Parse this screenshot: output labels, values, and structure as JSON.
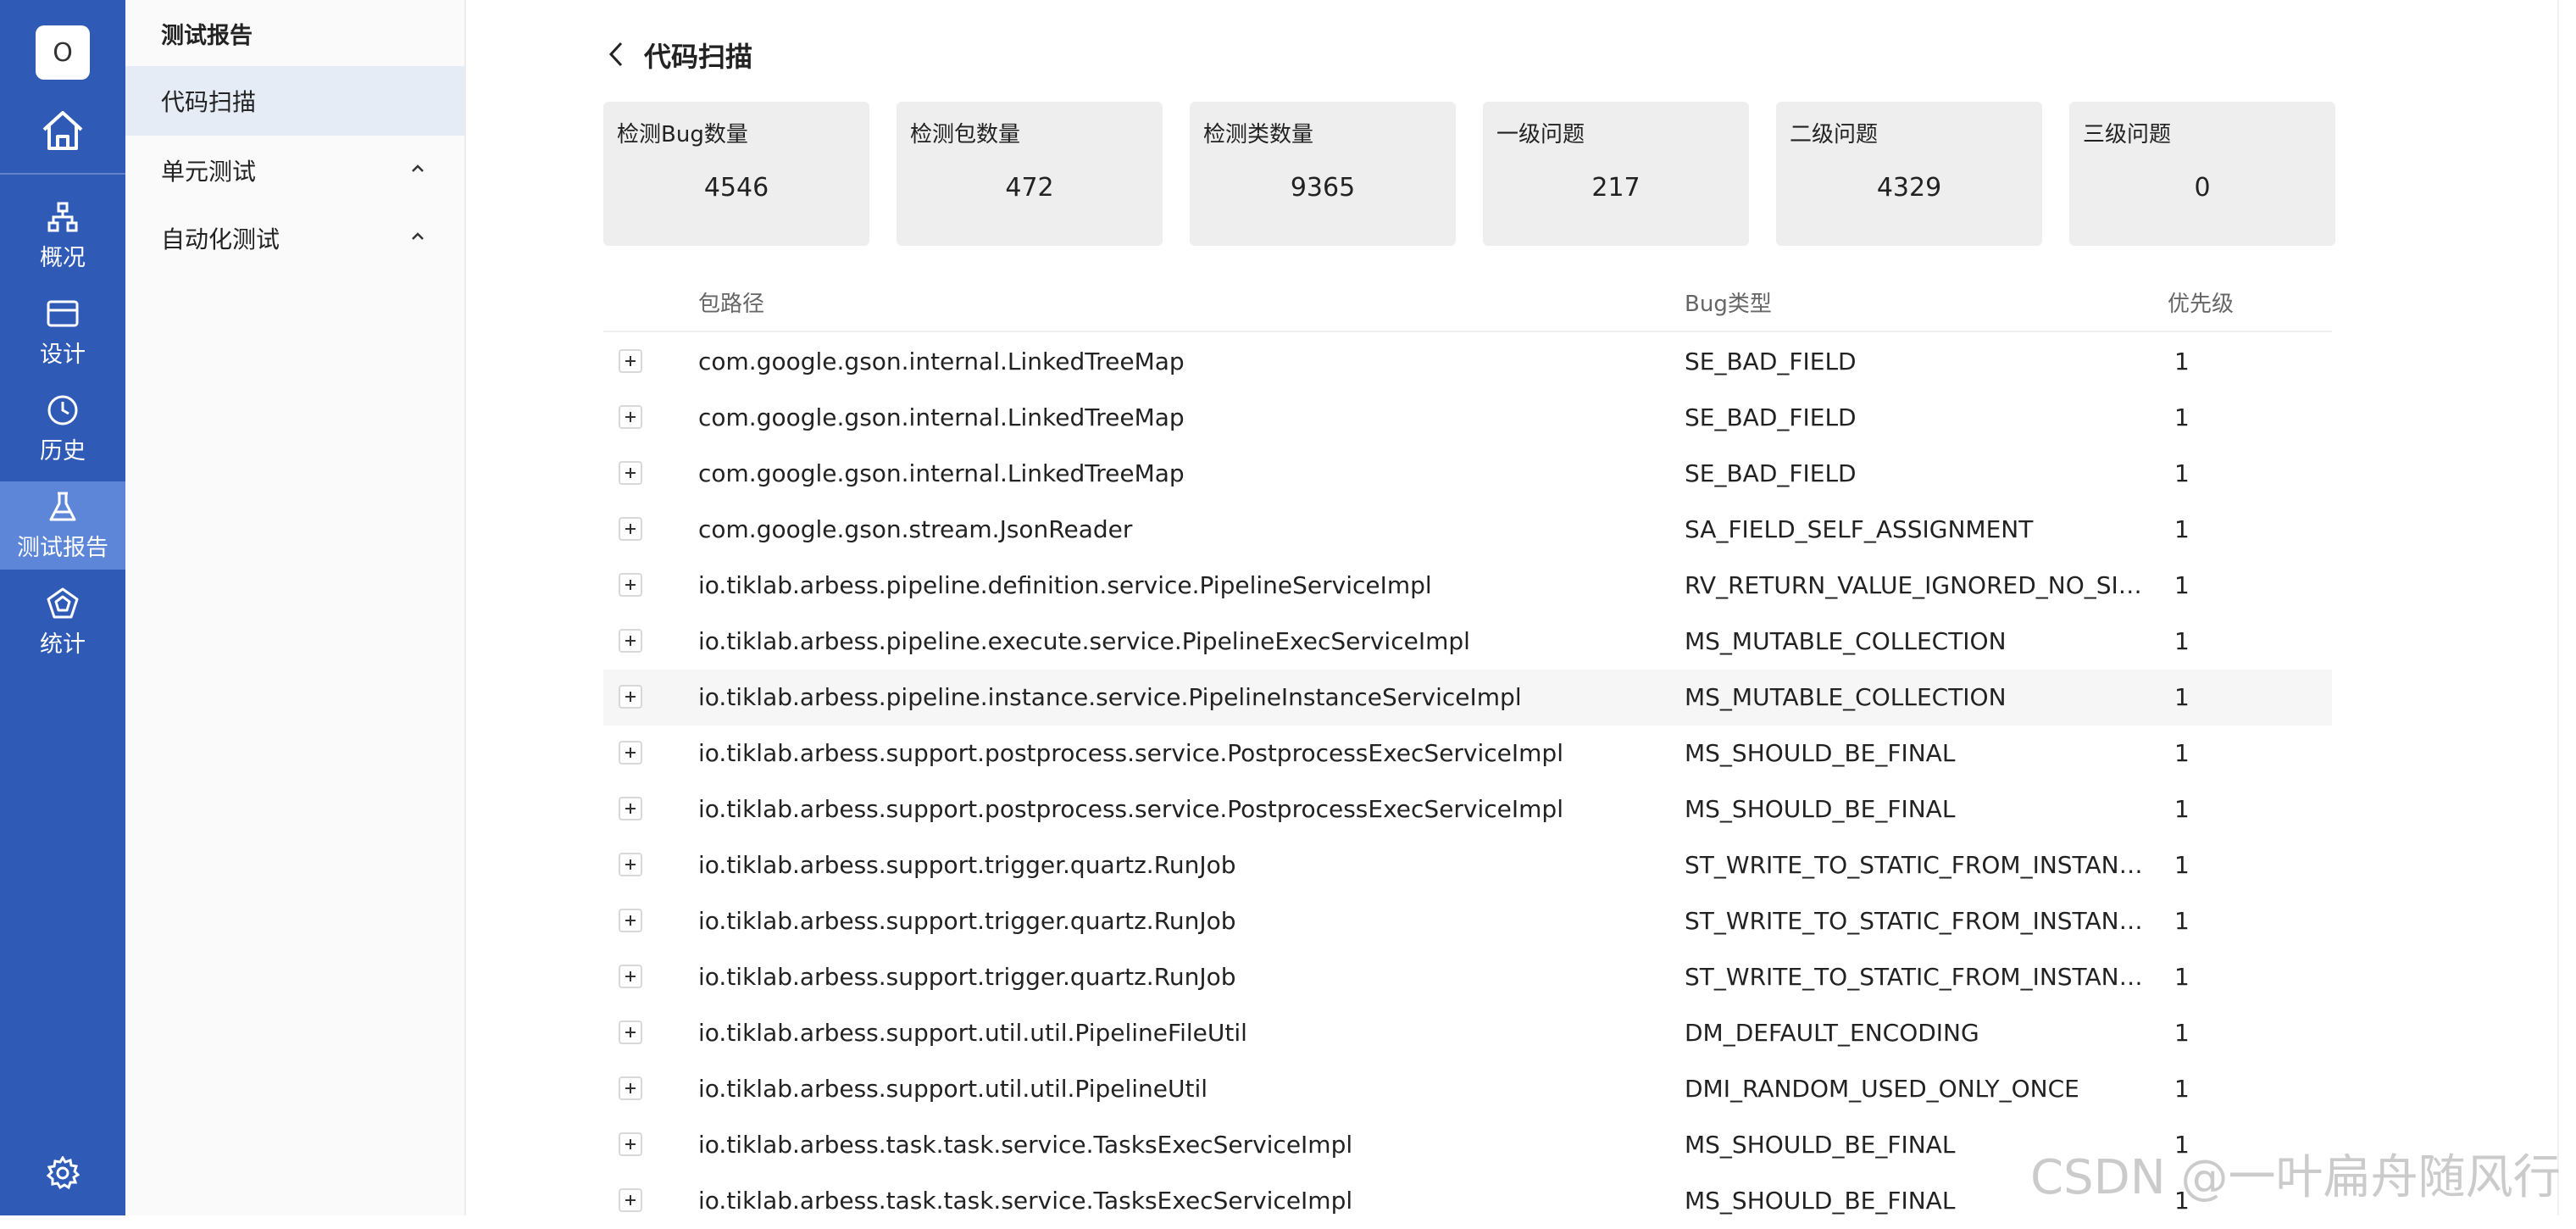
{
  "app": {
    "logo_letter": "O"
  },
  "rail": {
    "items": [
      {
        "label": "概况",
        "icon": "sitemap-icon"
      },
      {
        "label": "设计",
        "icon": "card-icon"
      },
      {
        "label": "历史",
        "icon": "clock-icon"
      },
      {
        "label": "测试报告",
        "icon": "flask-icon",
        "active": true
      },
      {
        "label": "统计",
        "icon": "pentagon-icon"
      }
    ],
    "accent_color": "#2f5bb7",
    "active_color": "#5d86d8"
  },
  "sidebar": {
    "title": "测试报告",
    "items": [
      {
        "label": "代码扫描",
        "active": true
      },
      {
        "label": "单元测试",
        "expandable": true
      },
      {
        "label": "自动化测试",
        "expandable": true
      }
    ]
  },
  "page": {
    "title": "代码扫描"
  },
  "stats": [
    {
      "label": "检测Bug数量",
      "value": "4546"
    },
    {
      "label": "检测包数量",
      "value": "472"
    },
    {
      "label": "检测类数量",
      "value": "9365"
    },
    {
      "label": "一级问题",
      "value": "217"
    },
    {
      "label": "二级问题",
      "value": "4329"
    },
    {
      "label": "三级问题",
      "value": "0"
    }
  ],
  "table": {
    "columns": {
      "path": "包路径",
      "type": "Bug类型",
      "priority": "优先级"
    },
    "rows": [
      {
        "path": "com.google.gson.internal.LinkedTreeMap",
        "type": "SE_BAD_FIELD",
        "priority": "1"
      },
      {
        "path": "com.google.gson.internal.LinkedTreeMap",
        "type": "SE_BAD_FIELD",
        "priority": "1"
      },
      {
        "path": "com.google.gson.internal.LinkedTreeMap",
        "type": "SE_BAD_FIELD",
        "priority": "1"
      },
      {
        "path": "com.google.gson.stream.JsonReader",
        "type": "SA_FIELD_SELF_ASSIGNMENT",
        "priority": "1"
      },
      {
        "path": "io.tiklab.arbess.pipeline.definition.service.PipelineServiceImpl",
        "type": "RV_RETURN_VALUE_IGNORED_NO_SID...",
        "priority": "1"
      },
      {
        "path": "io.tiklab.arbess.pipeline.execute.service.PipelineExecServiceImpl",
        "type": "MS_MUTABLE_COLLECTION",
        "priority": "1"
      },
      {
        "path": "io.tiklab.arbess.pipeline.instance.service.PipelineInstanceServiceImpl",
        "type": "MS_MUTABLE_COLLECTION",
        "priority": "1",
        "highlight": true
      },
      {
        "path": "io.tiklab.arbess.support.postprocess.service.PostprocessExecServiceImpl",
        "type": "MS_SHOULD_BE_FINAL",
        "priority": "1"
      },
      {
        "path": "io.tiklab.arbess.support.postprocess.service.PostprocessExecServiceImpl",
        "type": "MS_SHOULD_BE_FINAL",
        "priority": "1"
      },
      {
        "path": "io.tiklab.arbess.support.trigger.quartz.RunJob",
        "type": "ST_WRITE_TO_STATIC_FROM_INSTANC...",
        "priority": "1"
      },
      {
        "path": "io.tiklab.arbess.support.trigger.quartz.RunJob",
        "type": "ST_WRITE_TO_STATIC_FROM_INSTANC...",
        "priority": "1"
      },
      {
        "path": "io.tiklab.arbess.support.trigger.quartz.RunJob",
        "type": "ST_WRITE_TO_STATIC_FROM_INSTANC...",
        "priority": "1"
      },
      {
        "path": "io.tiklab.arbess.support.util.util.PipelineFileUtil",
        "type": "DM_DEFAULT_ENCODING",
        "priority": "1"
      },
      {
        "path": "io.tiklab.arbess.support.util.util.PipelineUtil",
        "type": "DMI_RANDOM_USED_ONLY_ONCE",
        "priority": "1"
      },
      {
        "path": "io.tiklab.arbess.task.task.service.TasksExecServiceImpl",
        "type": "MS_SHOULD_BE_FINAL",
        "priority": "1"
      },
      {
        "path": "io.tiklab.arbess.task.task.service.TasksExecServiceImpl",
        "type": "MS_SHOULD_BE_FINAL",
        "priority": "1"
      }
    ]
  },
  "watermark": "CSDN @一叶扁舟随风行"
}
